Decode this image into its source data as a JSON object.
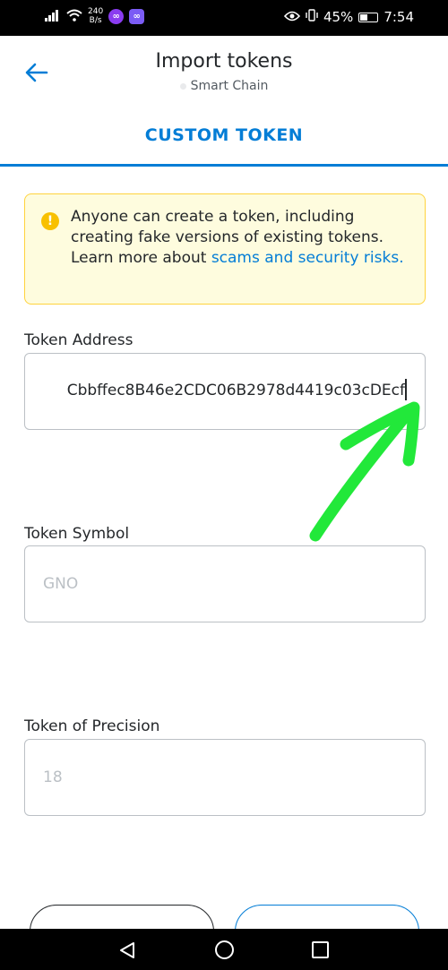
{
  "status_bar": {
    "net_speed_value": "240",
    "net_speed_unit": "B/s",
    "app_badge_1": "∞",
    "app_badge_2": "∞",
    "battery": "45%",
    "battery_level": 0.45,
    "time": "7:54",
    "icons": [
      "signal-icon",
      "wifi-icon",
      "eye-icon",
      "vibrate-icon",
      "battery-icon"
    ]
  },
  "header": {
    "title": "Import tokens",
    "network": "Smart Chain",
    "back_icon": "arrow-left-icon"
  },
  "tabs": {
    "active_label": "CUSTOM TOKEN"
  },
  "warning": {
    "icon": "exclamation-icon",
    "text": "Anyone can create a token, including creating fake versions of existing tokens. Learn more about ",
    "link": "scams and security risks."
  },
  "form": {
    "address": {
      "label": "Token Address",
      "value": "Cbbffec8B46e2CDC06B2978d4419c03cDEcf"
    },
    "symbol": {
      "label": "Token Symbol",
      "placeholder": "GNO"
    },
    "precision": {
      "label": "Token of Precision",
      "placeholder": "18"
    }
  },
  "colors": {
    "accent": "#037dd6",
    "warning_bg": "#fefcde",
    "warning_border": "#ffd33d",
    "annotation_arrow": "#22e83a"
  },
  "nav_bar": {
    "icons": [
      "nav-back-icon",
      "nav-home-icon",
      "nav-recents-icon"
    ]
  }
}
